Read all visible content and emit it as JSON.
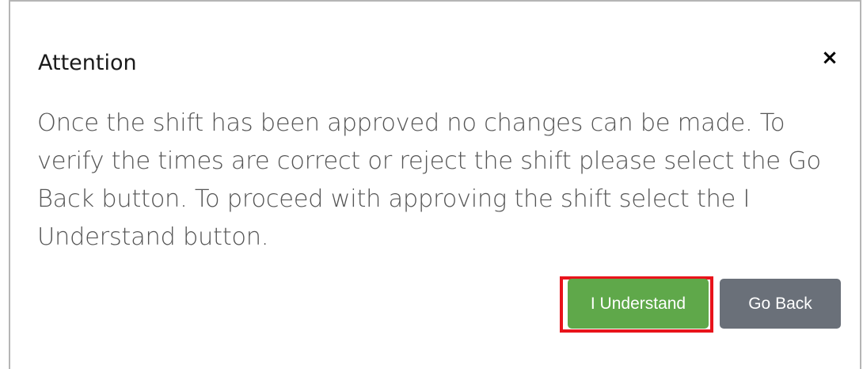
{
  "dialog": {
    "title": "Attention",
    "close_label": "×",
    "message": "Once the shift has been approved no changes can be made. To verify the times are correct or reject the shift please select the Go Back button. To proceed with approving the shift select the I Understand button.",
    "buttons": {
      "understand_label": "I Understand",
      "go_back_label": "Go Back"
    }
  },
  "colors": {
    "understand_button": "#5fa84a",
    "go_back_button": "#6a7079",
    "highlight_border": "#e8131b",
    "dialog_border": "#b5b5b5"
  }
}
